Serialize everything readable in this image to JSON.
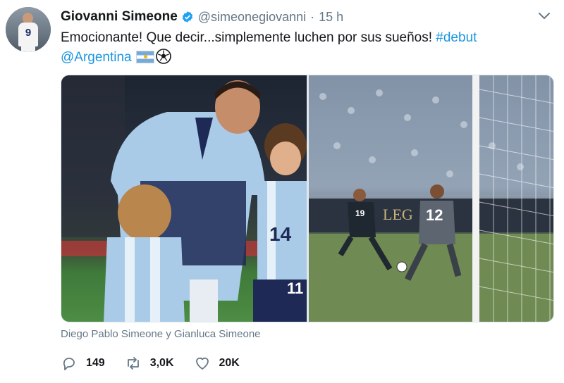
{
  "tweet": {
    "author_name": "Giovanni Simeone",
    "handle": "@simeonegiovanni",
    "separator": "·",
    "time": "15 h",
    "text_main": "Emocionante! Que decir...simplemente luchen por sus sueños!",
    "hashtag": "#debut",
    "mention": "@Argentina",
    "avatar_jersey_number": "9",
    "media_caption": "Diego Pablo Simeone y Gianluca Simeone",
    "left_photo": {
      "kid_number": "14",
      "kid2_number": "11"
    },
    "right_photo": {
      "keeper_number": "12",
      "striker_number": "19",
      "board_text": "LEG"
    },
    "stats": {
      "replies": "149",
      "retweets": "3,0K",
      "likes": "20K"
    }
  },
  "colors": {
    "link": "#1b95e0",
    "secondary_text": "#657786",
    "verified": "#1da1f2"
  },
  "icons": [
    "verified-badge-icon",
    "caret-down-icon",
    "argentina-flag-icon",
    "soccer-ball-icon",
    "reply-icon",
    "retweet-icon",
    "like-icon"
  ]
}
